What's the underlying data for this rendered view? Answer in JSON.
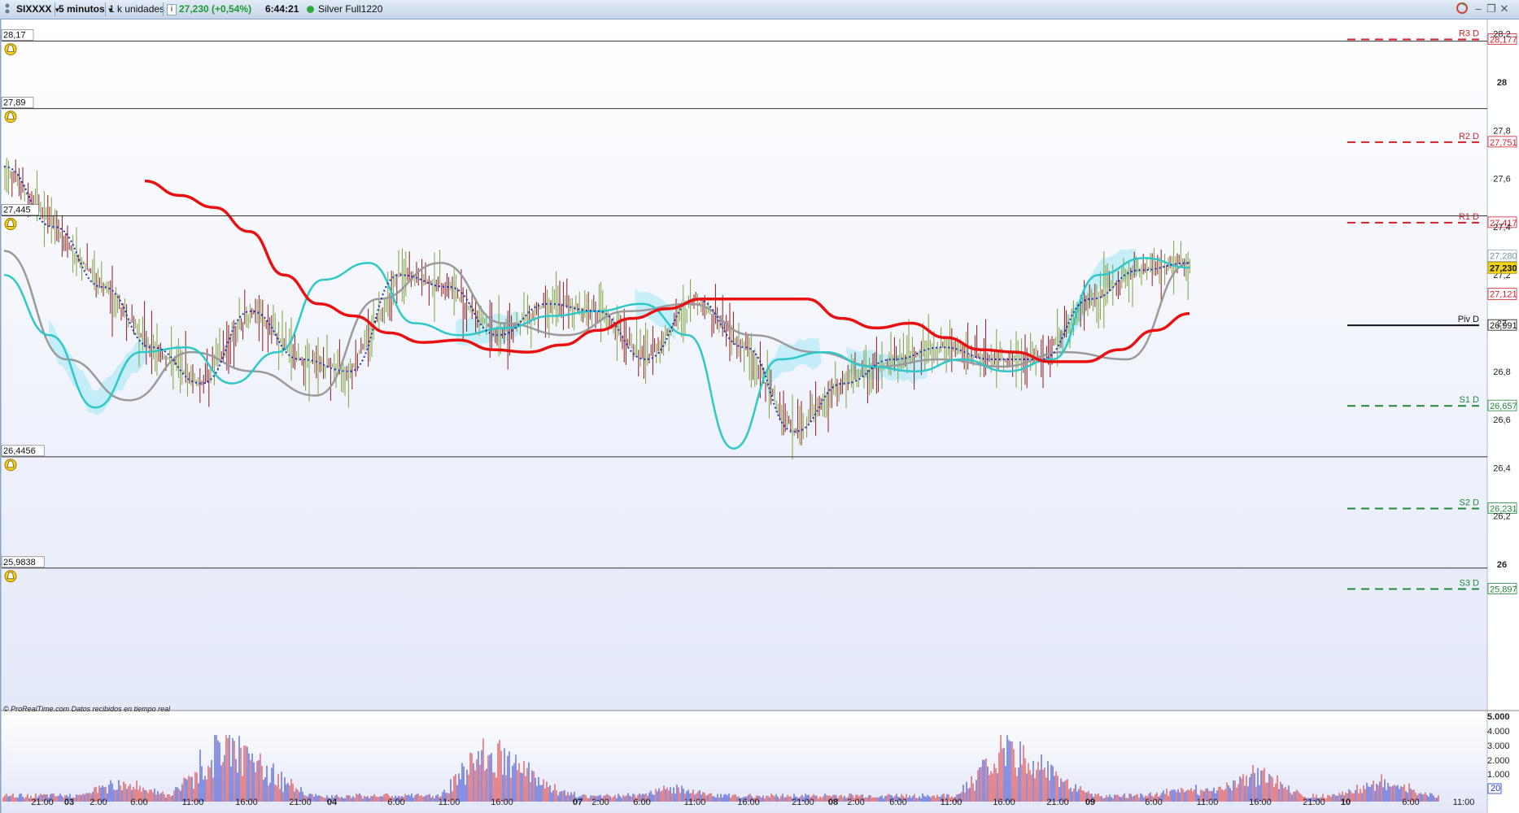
{
  "toolbar": {
    "symbol": "SIXXXX",
    "timeframe": "5 minutos",
    "units": "1 k unidades",
    "info_icon": "i",
    "price": "27,230 (+0,54%)",
    "time": "6:44:21",
    "status_dot_color": "#2eaa3c",
    "feed": "Silver Full1220",
    "icons": [
      "sync-icon",
      "minimize-icon",
      "restore-icon",
      "close-icon"
    ]
  },
  "colors": {
    "grid_bg_top": "#ffffff",
    "grid_bg_bottom": "#e4e9f9",
    "ma_red": "#e81010",
    "ma_teal": "#2fc8c8",
    "ma_gray": "#9a9a9a",
    "dotted_blue": "#2233bb",
    "candle_up": "#7ea03a",
    "candle_down": "#8b1a1a",
    "cloud": "#9ee8f6",
    "resistance": "#d2202a",
    "support": "#1f8a3a",
    "pivot": "#111111",
    "current_price_bg": "#f2d419"
  },
  "horizontal_lines": [
    "28,17",
    "27,89",
    "27,445",
    "26,4456",
    "25,9838"
  ],
  "pivots": [
    {
      "label": "R3 D",
      "value": "28,177",
      "kind": "resistance"
    },
    {
      "label": "R2 D",
      "value": "27,751",
      "kind": "resistance"
    },
    {
      "label": "R1 D",
      "value": "27,417",
      "kind": "resistance"
    },
    {
      "label": "Piv D",
      "value": "26,991",
      "kind": "pivot"
    },
    {
      "label": "S1 D",
      "value": "26,657",
      "kind": "support"
    },
    {
      "label": "S2 D",
      "value": "26,231",
      "kind": "support"
    },
    {
      "label": "S3 D",
      "value": "25,897",
      "kind": "support"
    }
  ],
  "price_axis_ticks": [
    "28,2",
    "28",
    "27,8",
    "27,6",
    "27,4",
    "27,2",
    "27",
    "26,8",
    "26,6",
    "26,4",
    "26,2",
    "26"
  ],
  "right_tags": [
    {
      "text": "27,280",
      "kind": "faded"
    },
    {
      "text": "27,230",
      "kind": "current"
    },
    {
      "text": "27,121",
      "kind": "resistance"
    }
  ],
  "volume_axis_ticks": [
    "5.000",
    "4.000",
    "3.000",
    "2.000",
    "1.000",
    "20"
  ],
  "time_axis": [
    {
      "label": "21:00",
      "bold": false
    },
    {
      "label": "03",
      "bold": true
    },
    {
      "label": "2:00",
      "bold": false
    },
    {
      "label": "6:00",
      "bold": false
    },
    {
      "label": "11:00",
      "bold": false
    },
    {
      "label": "16:00",
      "bold": false
    },
    {
      "label": "21:00",
      "bold": false
    },
    {
      "label": "04",
      "bold": true
    },
    {
      "label": "6:00",
      "bold": false
    },
    {
      "label": "11:00",
      "bold": false
    },
    {
      "label": "16:00",
      "bold": false
    },
    {
      "label": "07",
      "bold": true
    },
    {
      "label": "2:00",
      "bold": false
    },
    {
      "label": "6:00",
      "bold": false
    },
    {
      "label": "11:00",
      "bold": false
    },
    {
      "label": "16:00",
      "bold": false
    },
    {
      "label": "21:00",
      "bold": false
    },
    {
      "label": "08",
      "bold": true
    },
    {
      "label": "2:00",
      "bold": false
    },
    {
      "label": "6:00",
      "bold": false
    },
    {
      "label": "11:00",
      "bold": false
    },
    {
      "label": "16:00",
      "bold": false
    },
    {
      "label": "21:00",
      "bold": false
    },
    {
      "label": "09",
      "bold": true
    },
    {
      "label": "6:00",
      "bold": false
    },
    {
      "label": "11:00",
      "bold": false
    },
    {
      "label": "16:00",
      "bold": false
    },
    {
      "label": "21:00",
      "bold": false
    },
    {
      "label": "10",
      "bold": true
    },
    {
      "label": "6:00",
      "bold": false
    },
    {
      "label": "11:00",
      "bold": false
    }
  ],
  "footer_note": "© ProRealTime.com  Datos recibidos en tiempo real",
  "chart_data": {
    "type": "line",
    "ylim": [
      25.98,
      28.2
    ],
    "series": [
      {
        "values": [
          27.59,
          27.53,
          27.48,
          27.38,
          27.2,
          27.08,
          27.03,
          26.96,
          26.92,
          26.93,
          26.89,
          26.88,
          26.91,
          26.97,
          27.02,
          27.06,
          27.1,
          27.1,
          27.1,
          27.1,
          27.02,
          26.98,
          27.0,
          26.94,
          26.89,
          26.88,
          26.84,
          26.84,
          26.89,
          26.97,
          27.04
        ]
      },
      {
        "values": [
          27.2,
          26.95,
          26.65,
          26.88,
          26.9,
          26.75,
          26.88,
          27.18,
          27.25,
          27.0,
          26.95,
          26.98,
          27.03,
          27.05,
          27.08,
          26.95,
          26.48,
          26.85,
          26.88,
          26.82,
          26.8,
          26.85,
          26.8,
          26.85,
          27.2,
          27.27,
          27.23
        ]
      },
      {
        "values": [
          27.3,
          26.85,
          26.68,
          26.88,
          26.8,
          26.7,
          27.1,
          27.25,
          27.0,
          26.95,
          27.05,
          27.08,
          26.95,
          26.88,
          26.82,
          26.85,
          26.82,
          26.88,
          26.85,
          27.25
        ]
      },
      {
        "values": [
          27.65,
          27.4,
          27.15,
          26.9,
          26.75,
          27.05,
          26.85,
          26.8,
          27.2,
          27.15,
          26.95,
          27.08,
          27.05,
          26.85,
          27.1,
          26.9,
          26.55,
          26.75,
          26.85,
          26.9,
          26.85,
          26.85,
          27.1,
          27.22,
          27.25
        ]
      }
    ]
  }
}
